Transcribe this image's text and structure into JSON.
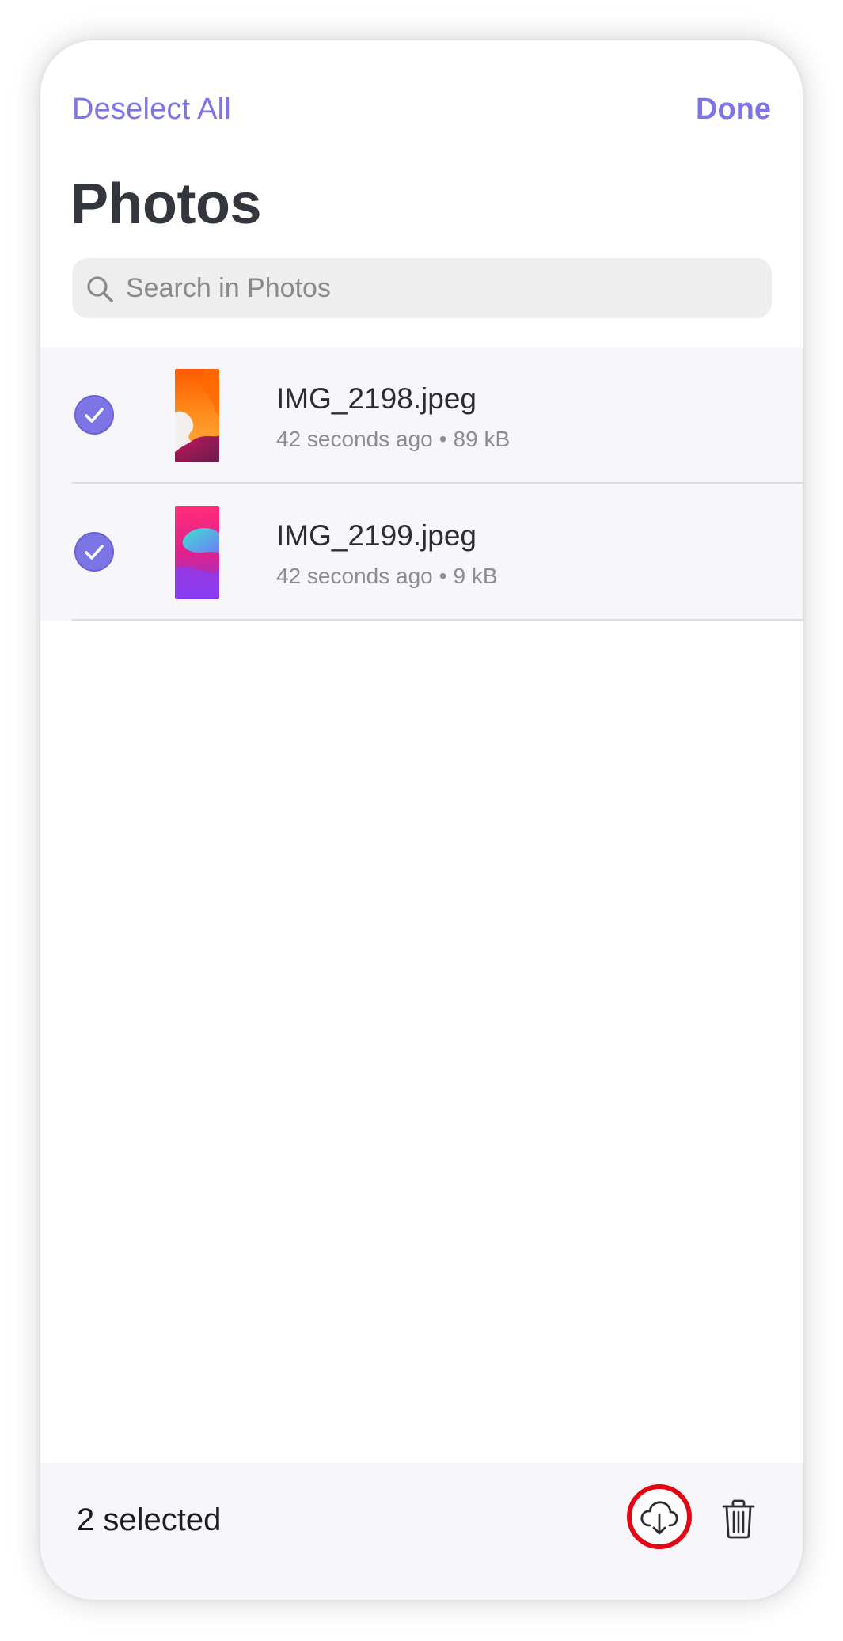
{
  "nav": {
    "deselect_label": "Deselect All",
    "done_label": "Done"
  },
  "page": {
    "title": "Photos"
  },
  "search": {
    "placeholder": "Search in Photos",
    "value": "",
    "icon": "search-icon"
  },
  "files": [
    {
      "name": "IMG_2198.jpeg",
      "time": "42 seconds ago",
      "size": "89 kB",
      "selected": true,
      "thumbnail": "orange-abstract-wallpaper"
    },
    {
      "name": "IMG_2199.jpeg",
      "time": "42 seconds ago",
      "size": "9 kB",
      "selected": true,
      "thumbnail": "pink-purple-abstract-wallpaper"
    }
  ],
  "separator": "•",
  "bottom_bar": {
    "selected_text": "2 selected",
    "download_icon": "cloud-download-icon",
    "trash_icon": "trash-icon"
  },
  "colors": {
    "accent": "#7d75e6",
    "highlight_ring": "#e30613",
    "row_background": "#f6f6fb",
    "title": "#33363c"
  }
}
